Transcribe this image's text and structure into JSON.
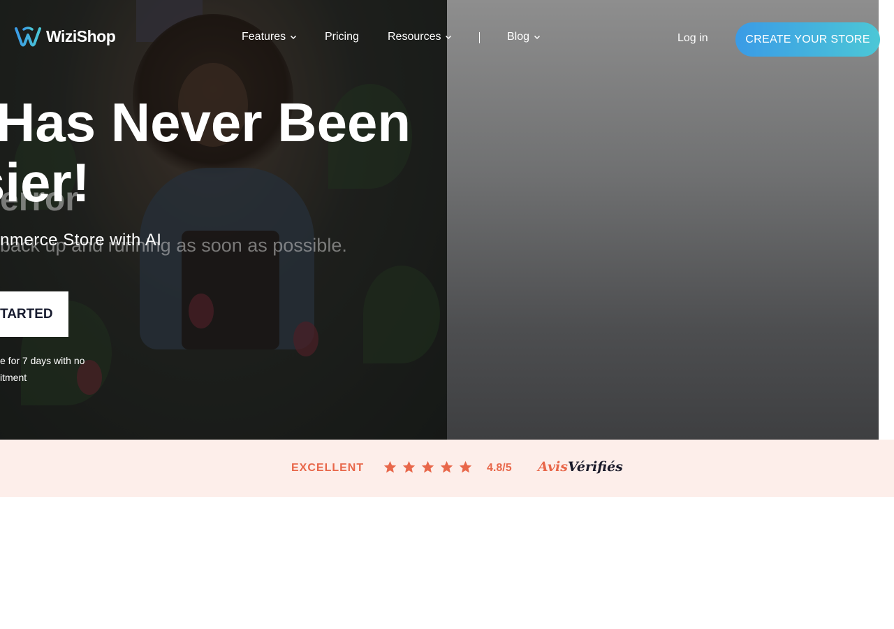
{
  "brand": {
    "name": "WiziShop"
  },
  "nav": {
    "items": [
      {
        "label": "Features",
        "has_dropdown": true
      },
      {
        "label": "Pricing",
        "has_dropdown": false
      },
      {
        "label": "Resources",
        "has_dropdown": true
      },
      {
        "label": "Blog",
        "has_dropdown": true
      }
    ],
    "login_label": "Log in",
    "create_store_label": "CREATE YOUR STORE"
  },
  "hero": {
    "title_line1": "Has Never Been",
    "title_line2": "sier!",
    "subtitle": "nmerce Store with AI",
    "ghost_error_title": "error",
    "ghost_error_text": "back up and running as soon as possible.",
    "cta_label": "TARTED",
    "trial_line1": "e for 7 days with no",
    "trial_line2": "itment"
  },
  "rating": {
    "label": "EXCELLENT",
    "stars": 5,
    "score": "4.8/5",
    "provider_part1": "Avis",
    "provider_part2": "Vérifiés"
  },
  "colors": {
    "accent": "#e8674a",
    "rating_bg": "#fdeeea",
    "cta_gradient_start": "#3a9be6",
    "cta_gradient_end": "#4cc7d6",
    "dark_text": "#161a2e"
  },
  "icons": {
    "logo": "wizishop-w-logo-icon",
    "dropdown": "chevron-down-icon",
    "star": "star-icon"
  }
}
